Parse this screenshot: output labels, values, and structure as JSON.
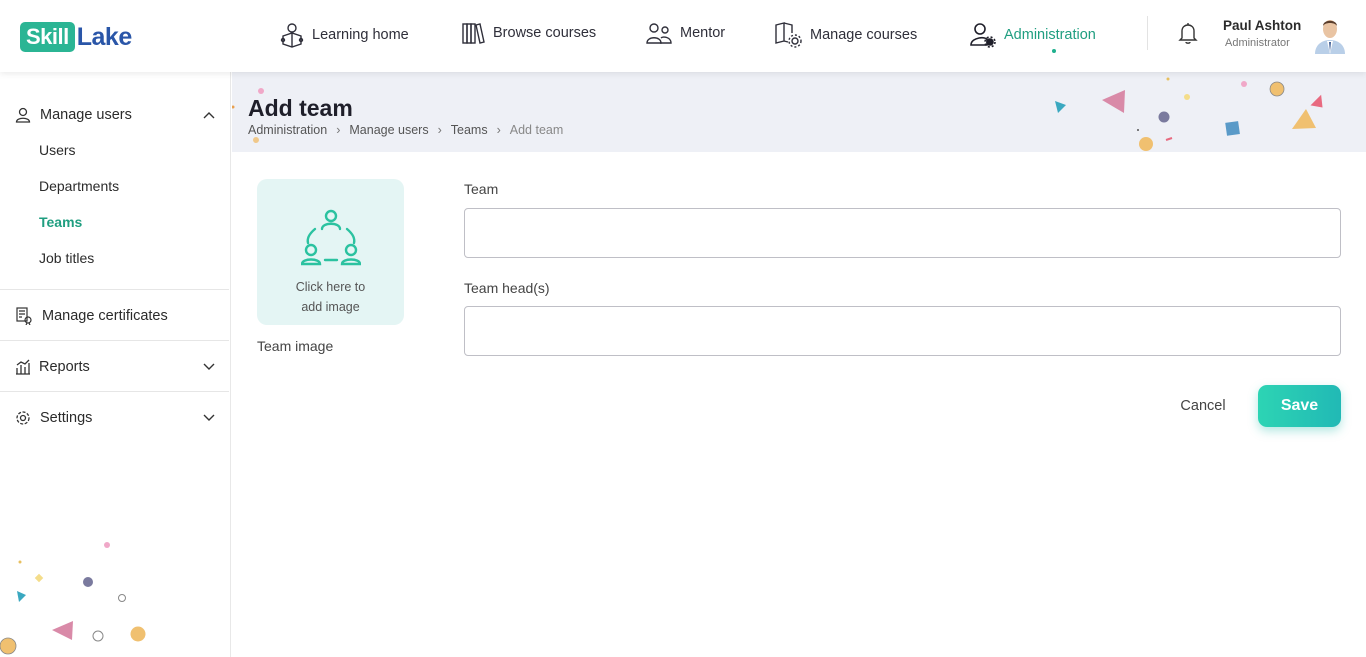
{
  "brand": {
    "part1": "Skill",
    "part2": "Lake"
  },
  "nav": [
    {
      "label": "Learning home",
      "icon": "learning-home-icon"
    },
    {
      "label": "Browse courses",
      "icon": "books-icon"
    },
    {
      "label": "Mentor",
      "icon": "mentor-icon"
    },
    {
      "label": "Manage courses",
      "icon": "manage-courses-icon"
    },
    {
      "label": "Administration",
      "icon": "admin-user-gear-icon",
      "active": true
    }
  ],
  "user": {
    "name": "Paul Ashton",
    "role": "Administrator"
  },
  "sidebar": {
    "manage_users": {
      "label": "Manage users",
      "expanded": true,
      "items": [
        "Users",
        "Departments",
        "Teams",
        "Job titles"
      ],
      "active_item": "Teams"
    },
    "manage_certificates": {
      "label": "Manage certificates"
    },
    "reports": {
      "label": "Reports"
    },
    "settings": {
      "label": "Settings"
    }
  },
  "page": {
    "title": "Add team",
    "breadcrumb": [
      "Administration",
      "Manage users",
      "Teams",
      "Add team"
    ]
  },
  "form": {
    "image_hint_line1": "Click here to",
    "image_hint_line2": "add image",
    "image_label": "Team image",
    "team_label": "Team",
    "team_value": "",
    "team_head_label": "Team head(s)",
    "team_head_value": "",
    "cancel_label": "Cancel",
    "save_label": "Save"
  },
  "colors": {
    "accent": "#1f9e80",
    "band": "#eef0f6",
    "save_start": "#2dd4b4",
    "save_end": "#21b9b5"
  }
}
